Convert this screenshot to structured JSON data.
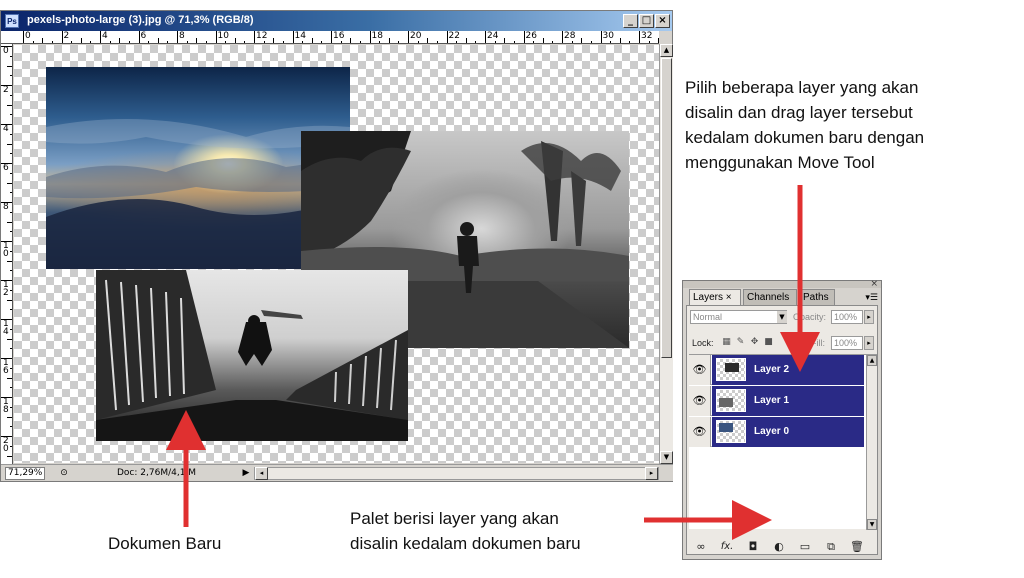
{
  "window": {
    "title": "pexels-photo-large (3).jpg @ 71,3% (RGB/8)",
    "app_icon": "Ps",
    "minimize": "_",
    "maximize": "□",
    "close": "×"
  },
  "ruler": {
    "h_labels": [
      "0",
      "2",
      "4",
      "6",
      "8",
      "10",
      "12",
      "14",
      "16",
      "18",
      "20",
      "22",
      "24",
      "26",
      "28",
      "30",
      "32"
    ],
    "v_labels": [
      "0",
      "2",
      "4",
      "6",
      "8",
      "1\n0",
      "1\n2",
      "1\n4",
      "1\n6",
      "1\n8",
      "2\n0"
    ]
  },
  "status": {
    "zoom": "71,29%",
    "doc_info": "Doc: 2,76M/4,1 M",
    "play": "▶",
    "left_arrow": "◂",
    "right_arrow": "▸"
  },
  "layers_panel": {
    "tabs": [
      {
        "label": "Layers ×",
        "active": true
      },
      {
        "label": "Channels",
        "active": false
      },
      {
        "label": "Paths",
        "active": false
      }
    ],
    "close": "×",
    "menu": "▾☰",
    "blend_mode": "Normal",
    "opacity_label": "Opacity:",
    "opacity_value": "100%",
    "lock_label": "Lock:",
    "fill_label": "Fill:",
    "fill_value": "100%",
    "layers": [
      {
        "name": "Layer 2",
        "visible": true,
        "selected": true
      },
      {
        "name": "Layer 1",
        "visible": true,
        "selected": true
      },
      {
        "name": "Layer 0",
        "visible": true,
        "selected": true
      }
    ],
    "footer_icons": [
      "link-icon",
      "fx-icon",
      "mask-icon",
      "adjustment-icon",
      "group-icon",
      "new-layer-icon",
      "trash-icon"
    ]
  },
  "annotations": {
    "top_note": [
      "Pilih beberapa layer yang akan",
      "disalin dan drag layer tersebut",
      "kedalam dokumen baru dengan",
      "menggunakan Move Tool"
    ],
    "palette_note": [
      "Palet berisi layer yang akan",
      "disalin kedalam dokumen baru"
    ],
    "doc_note": "Dokumen Baru"
  },
  "colors": {
    "selected_layer": "#2a2a86",
    "arrow": "#e03030",
    "title_bar": "#0a246a"
  }
}
